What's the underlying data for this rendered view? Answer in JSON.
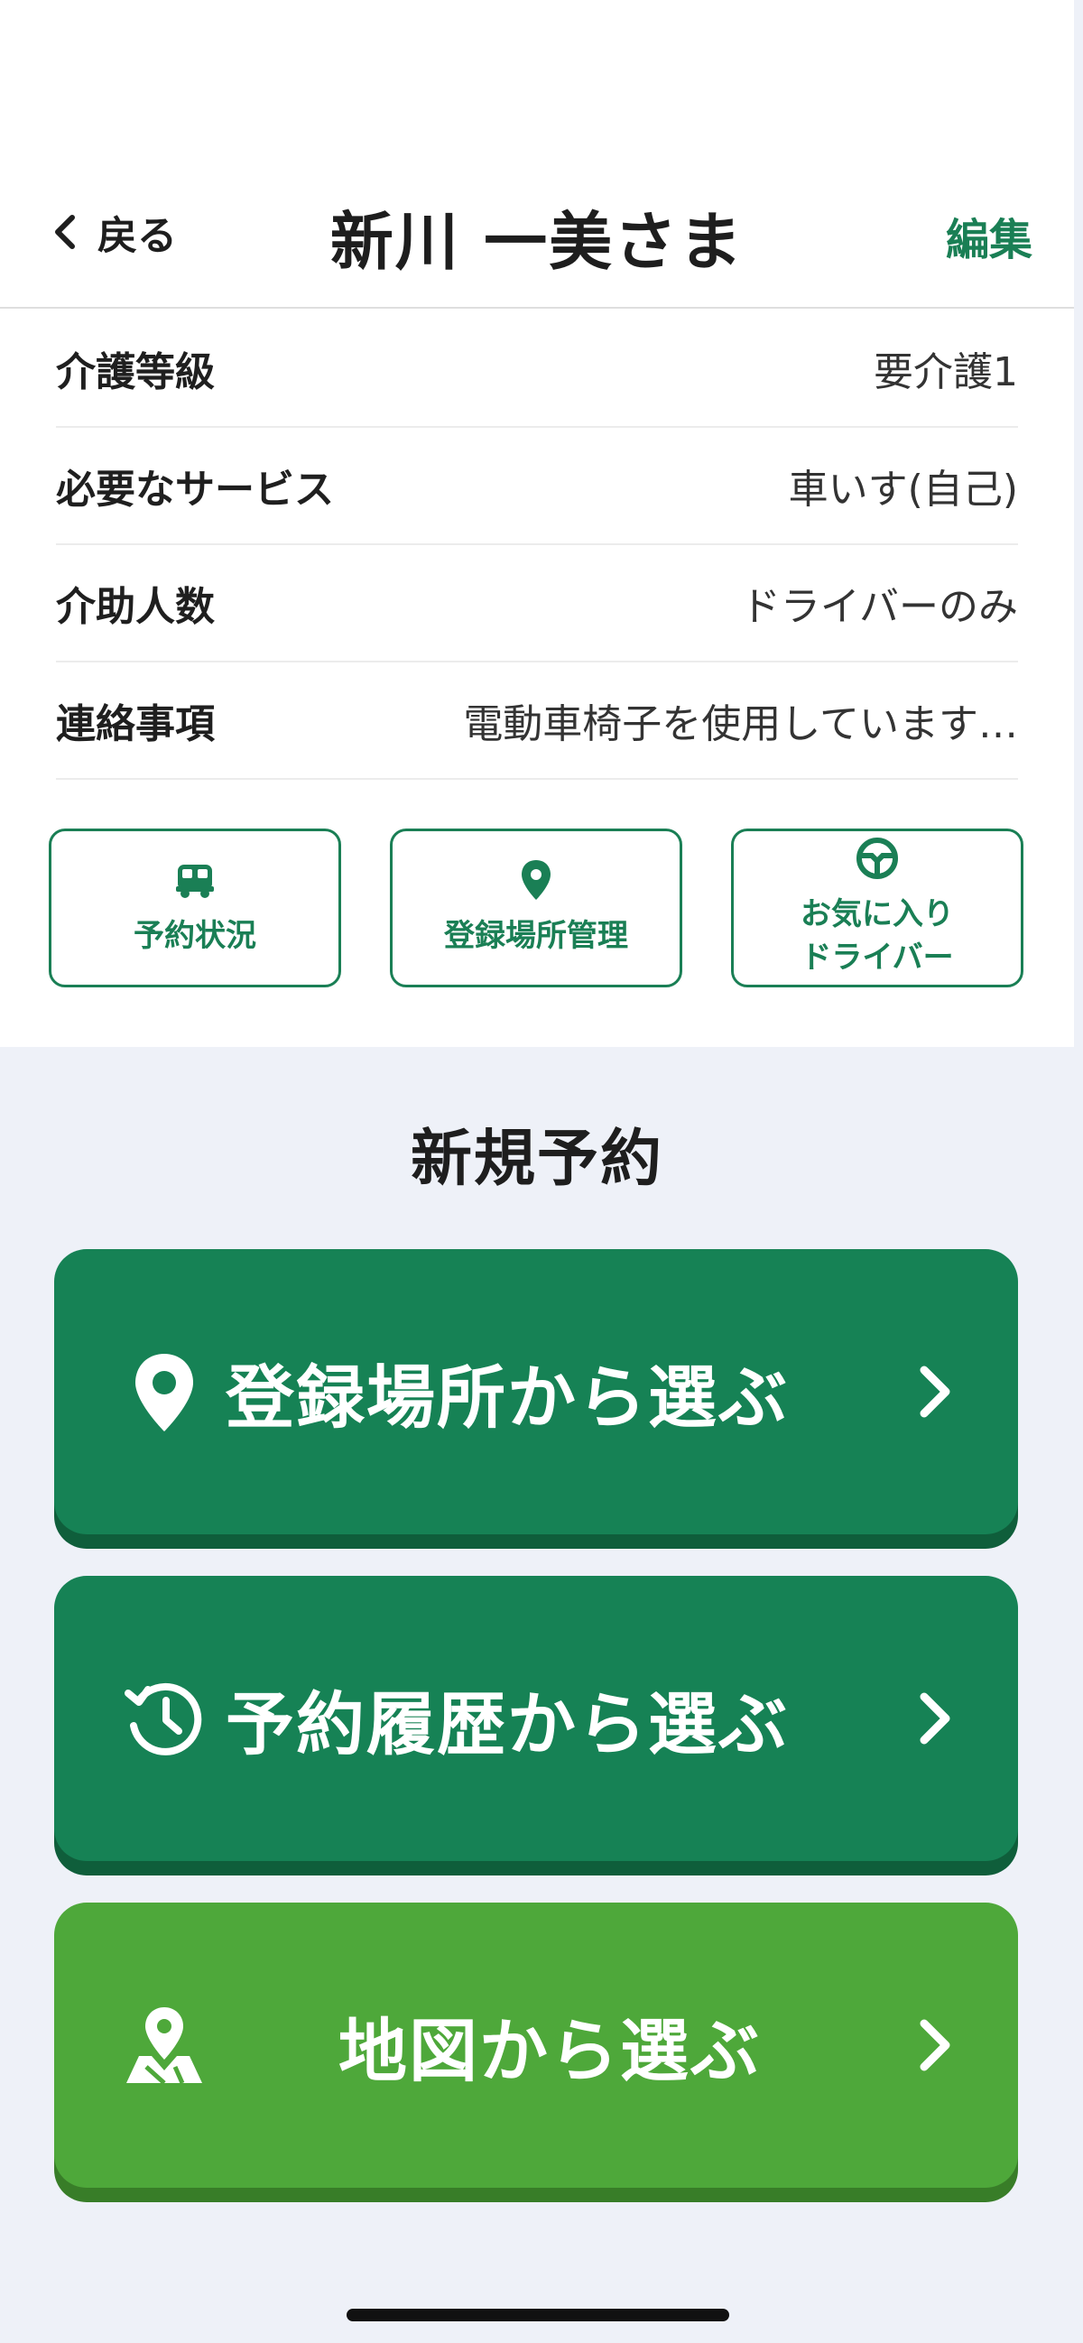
{
  "nav": {
    "back_label": "戻る",
    "title": "新川 一美さま",
    "edit_label": "編集"
  },
  "info": [
    {
      "label": "介護等級",
      "value": "要介護1"
    },
    {
      "label": "必要なサービス",
      "value": "車いす(自己)"
    },
    {
      "label": "介助人数",
      "value": "ドライバーのみ"
    },
    {
      "label": "連絡事項",
      "value": "電動車椅子を使用しています…"
    }
  ],
  "quick_actions": [
    {
      "label": "予約状況",
      "icon": "car-icon"
    },
    {
      "label": "登録場所管理",
      "icon": "map-pin-icon"
    },
    {
      "label": "お気に入り\nドライバー",
      "icon": "steering-wheel-icon"
    }
  ],
  "new_booking": {
    "title": "新規予約",
    "buttons": [
      {
        "label": "登録場所から選ぶ",
        "icon": "map-pin-icon"
      },
      {
        "label": "予約履歴から選ぶ",
        "icon": "history-icon"
      },
      {
        "label": "地図から選ぶ",
        "icon": "map-location-icon"
      }
    ]
  },
  "colors": {
    "brand_green": "#1a7f55",
    "button_dark_green": "#168255",
    "button_light_green": "#4ea83a",
    "background": "#eef1f8"
  }
}
